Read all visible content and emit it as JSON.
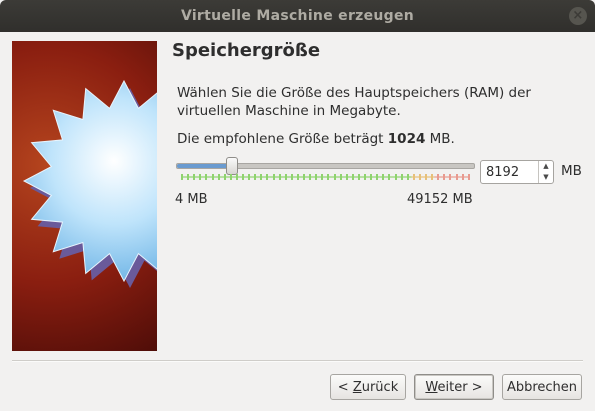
{
  "window": {
    "title": "Virtuelle Maschine erzeugen",
    "close_glyph": "×"
  },
  "page": {
    "heading": "Speichergröße",
    "description": "Wählen Sie die Größe des Hauptspeichers (RAM) der virtuellen Maschine in Megabyte.",
    "recommended_prefix": "Die empfohlene Größe beträgt ",
    "recommended_value": "1024",
    "recommended_suffix": " MB."
  },
  "memory": {
    "slider_fraction": 0.1833,
    "min_label": "4 MB",
    "max_label": "49152 MB",
    "value": "8192",
    "unit": "MB",
    "scale_colors": {
      "safe": "#8fd36e",
      "warn": "#e7c07a",
      "danger": "#e89a8f"
    },
    "safe_fraction": 0.8,
    "warn_fraction": 0.88
  },
  "buttons": {
    "back_pre": "< ",
    "back_mnemonic": "Z",
    "back_post": "urück",
    "next_mnemonic": "W",
    "next_post": "eiter >",
    "cancel": "Abbrechen"
  }
}
